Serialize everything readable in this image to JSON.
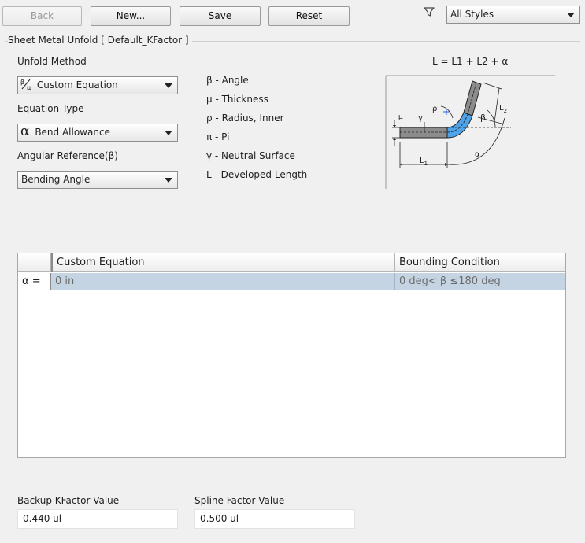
{
  "toolbar": {
    "back_label": "Back",
    "new_label": "New...",
    "save_label": "Save",
    "reset_label": "Reset",
    "filter_icon": "filter-icon",
    "style_filter_value": "All Styles"
  },
  "group": {
    "title": "Sheet Metal Unfold [ Default_KFactor ]"
  },
  "form": {
    "unfold_method_label": "Unfold Method",
    "unfold_method_value": "Custom Equation",
    "unfold_method_icon": "custom-equation-icon",
    "equation_type_label": "Equation Type",
    "equation_type_value": "Bend Allowance",
    "equation_type_icon_glyph": "α",
    "angular_reference_label": "Angular Reference(β)",
    "angular_reference_value": "Bending Angle"
  },
  "legend": [
    "β - Angle",
    "μ - Thickness",
    "ρ - Radius, Inner",
    "π - Pi",
    "γ - Neutral Surface",
    "L - Developed Length"
  ],
  "diagram": {
    "formula": "L = L1 + L2 + α",
    "labels": {
      "mu": "μ",
      "gamma": "γ",
      "rho": "ρ",
      "beta": "β",
      "alpha": "α",
      "L1": "L",
      "L1_sub": "1",
      "L2": "L",
      "L2_sub": "2"
    },
    "colors": {
      "plate": "#8c8c8c",
      "bend": "#4fa3e8",
      "outline": "#222222"
    }
  },
  "table": {
    "columns": [
      "",
      "Custom Equation",
      "Bounding Condition"
    ],
    "rows": [
      {
        "label": "α =",
        "equation": "0 in",
        "condition": "0 deg< β ≤180 deg"
      }
    ]
  },
  "footer": {
    "backup_kfactor_label": "Backup KFactor Value",
    "backup_kfactor_value": "0.440 ul",
    "spline_factor_label": "Spline Factor Value",
    "spline_factor_value": "0.500 ul"
  }
}
